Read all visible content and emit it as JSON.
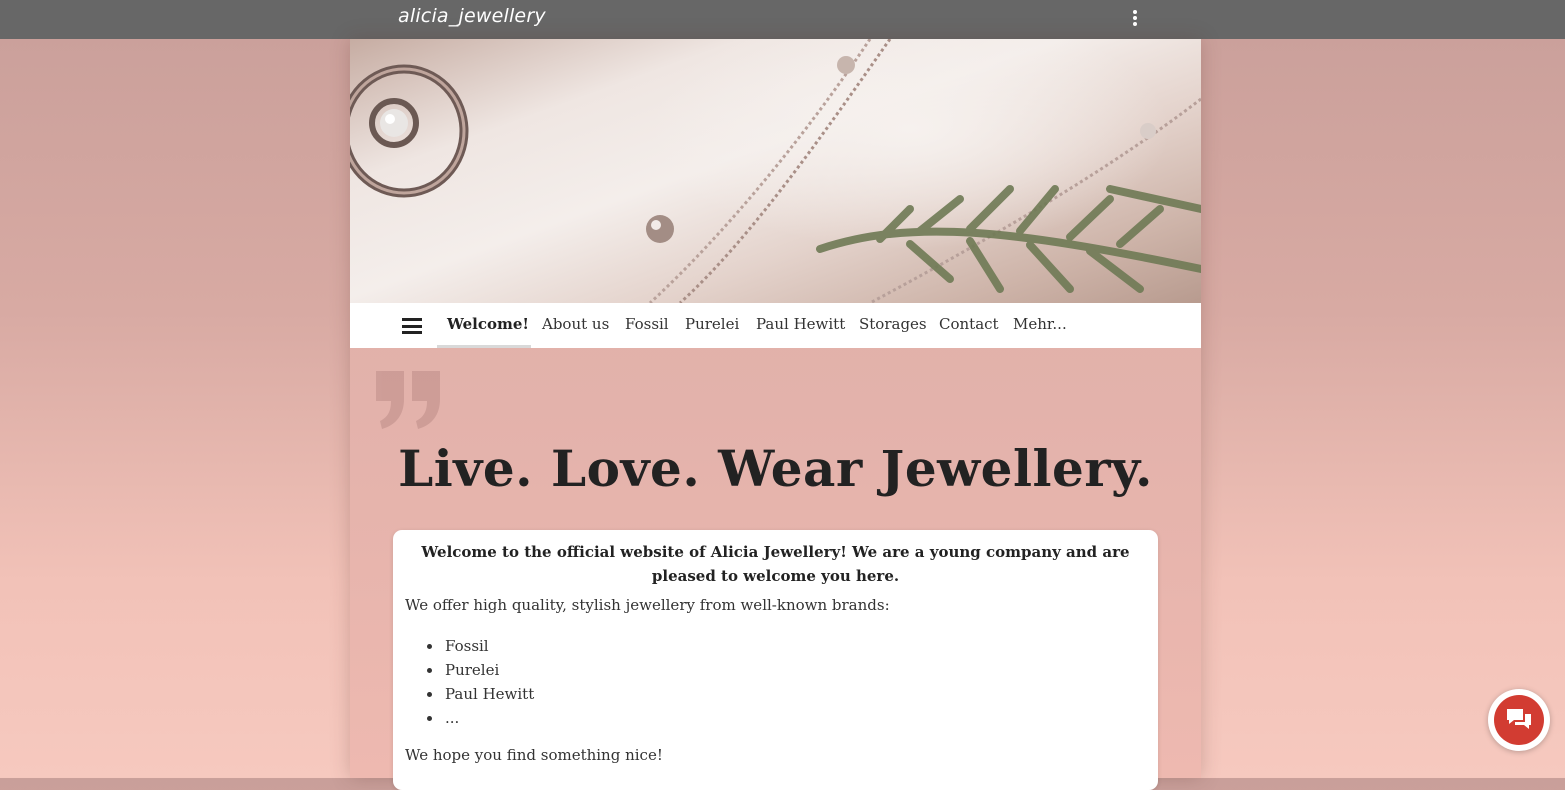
{
  "topbar": {
    "brand": "alicia_jewellery",
    "menu_icon": "more-vertical-icon"
  },
  "hero": {
    "image": "jewellery-necklace-photo"
  },
  "nav": {
    "menu_icon": "hamburger-icon",
    "items": [
      {
        "label": "Welcome!",
        "active": true
      },
      {
        "label": "About us"
      },
      {
        "label": "Fossil"
      },
      {
        "label": "Purelei"
      },
      {
        "label": "Paul Hewitt"
      },
      {
        "label": "Storages"
      },
      {
        "label": "Contact"
      },
      {
        "label": "Mehr..."
      }
    ]
  },
  "main": {
    "quote_icon": "quote-icon",
    "headline": "Live. Love. Wear Jewellery.",
    "card": {
      "lead": "Welcome to the official website of Alicia Jewellery! We are a young company and are pleased to welcome you here.",
      "intro": "We offer high quality, stylish jewellery from well-known brands:",
      "brands": [
        "Fossil",
        "Purelei",
        "Paul Hewitt",
        "..."
      ],
      "outro": "We hope you find something nice!"
    }
  },
  "chat": {
    "icon": "chat-bubbles-icon"
  },
  "colors": {
    "topbar": "#676767",
    "chat_button": "#d23c32",
    "accent_bg": "#e3b2ab"
  }
}
